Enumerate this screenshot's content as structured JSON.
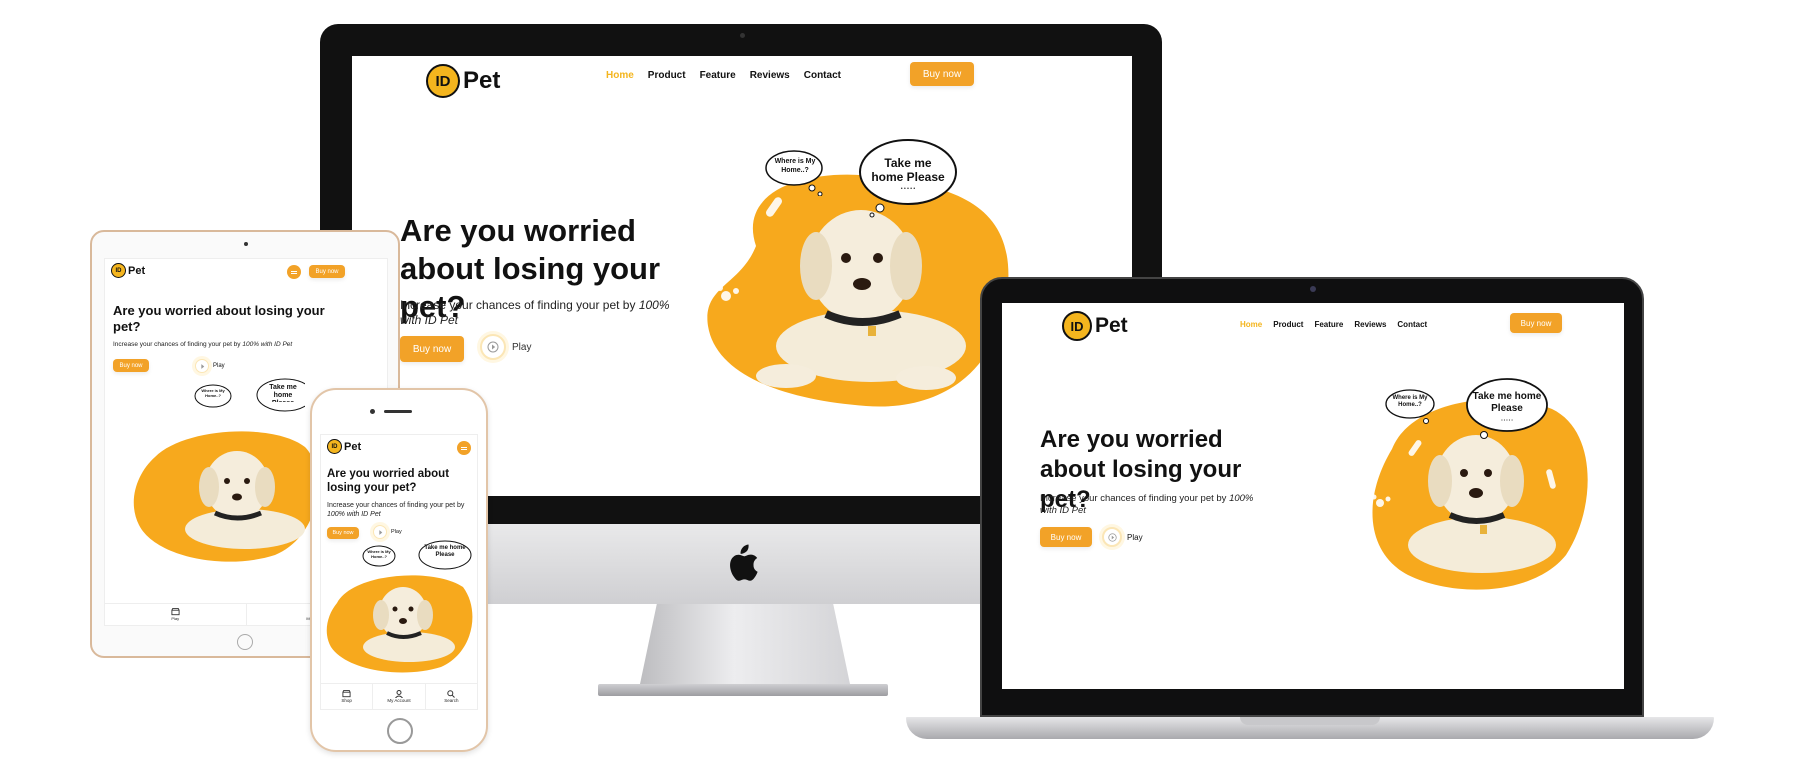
{
  "site": {
    "logo_id": "ID",
    "logo_word": "Pet",
    "nav": [
      "Home",
      "Product",
      "Feature",
      "Reviews",
      "Contact"
    ],
    "buy_now": "Buy now",
    "headline": "Are you worried about losing your pet?",
    "subtext_prefix": "Increase your chances of finding your pet by ",
    "subtext_emphasis": "100% with ID Pet",
    "play_label": "Play",
    "bubble_small": "Where is My Home..?",
    "bubble_large": "Take me home Please",
    "bubble_dots": "• • • • •"
  },
  "tablet_bottom_nav": [
    "Play",
    "My Account"
  ],
  "phone_bottom_nav": [
    "Shop",
    "My Account",
    "Search"
  ],
  "colors": {
    "accent": "#f2a228",
    "logo": "#f4b51e",
    "blob": "#f7a91d",
    "text": "#111111"
  }
}
